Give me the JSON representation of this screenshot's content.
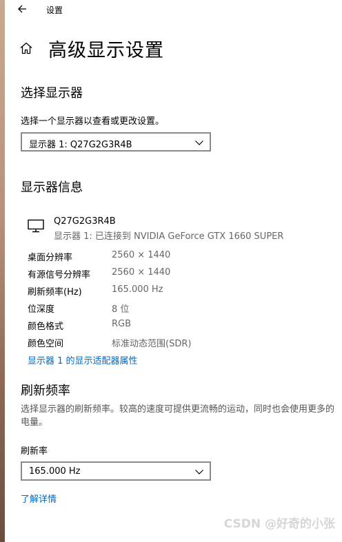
{
  "app": {
    "title": "设置"
  },
  "page": {
    "title": "高级显示设置"
  },
  "select_display": {
    "heading": "选择显示器",
    "instruction": "选择一个显示器以查看或更改设置。",
    "selected": "显示器 1: Q27G2G3R4B"
  },
  "display_info": {
    "heading": "显示器信息",
    "monitor_name": "Q27G2G3R4B",
    "monitor_sub": "显示器 1: 已连接到 NVIDIA GeForce GTX 1660 SUPER",
    "rows": [
      {
        "label": "桌面分辨率",
        "value": "2560 × 1440"
      },
      {
        "label": "有源信号分辨率",
        "value": "2560 × 1440"
      },
      {
        "label": "刷新频率(Hz)",
        "value": "165.000 Hz"
      },
      {
        "label": "位深度",
        "value": "8 位"
      },
      {
        "label": "颜色格式",
        "value": "RGB"
      },
      {
        "label": "颜色空间",
        "value": "标准动态范围(SDR)"
      }
    ],
    "adapter_link": "显示器 1 的显示适配器属性"
  },
  "refresh": {
    "heading": "刷新频率",
    "description": "选择显示器的刷新频率。较高的速度可提供更流畅的运动，同时也会使用更多的电量。",
    "rate_label": "刷新率",
    "selected_rate": "165.000 Hz",
    "learn_more": "了解详情"
  },
  "watermark": "CSDN @好奇的小张",
  "colors": {
    "accent_link": "#0067c0",
    "secondary_text": "#666666",
    "dropdown_border": "#8a8a8a"
  },
  "icons": {
    "back": "back-arrow-icon",
    "home": "home-icon",
    "monitor": "monitor-icon",
    "chevron": "chevron-down-icon"
  }
}
